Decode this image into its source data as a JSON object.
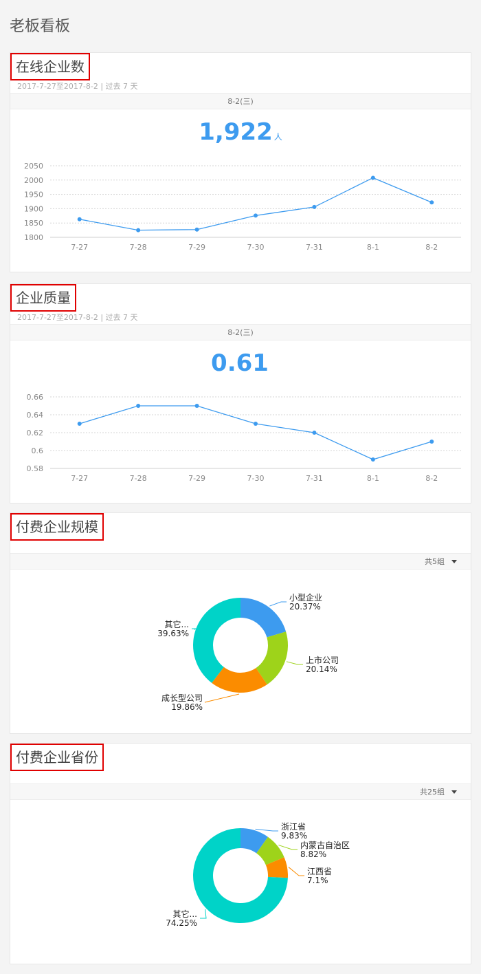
{
  "page": {
    "title": "老板看板"
  },
  "cards": [
    {
      "title": "在线企业数",
      "subtitle": "2017-7-27至2017-8-2 | 过去 7 天",
      "date_label": "8-2(三)",
      "big_value": "1,922",
      "big_unit": "人"
    },
    {
      "title": "企业质量",
      "subtitle": "2017-7-27至2017-8-2 | 过去 7 天",
      "date_label": "8-2(三)",
      "big_value": "0.61",
      "big_unit": ""
    },
    {
      "title": "付费企业规模",
      "group_label": "共5组"
    },
    {
      "title": "付费企业省份",
      "group_label": "共25组"
    }
  ],
  "chart_data": [
    {
      "type": "line",
      "categories": [
        "7-27",
        "7-28",
        "7-29",
        "7-30",
        "7-31",
        "8-1",
        "8-2"
      ],
      "series": [
        {
          "values": [
            1863,
            1825,
            1827,
            1876,
            1906,
            2008,
            1922
          ]
        }
      ],
      "yticks": [
        1800,
        1850,
        1900,
        1950,
        2000,
        2050
      ],
      "ylim": [
        1800,
        2050
      ],
      "color": "#3d9bef",
      "grid": true
    },
    {
      "type": "line",
      "categories": [
        "7-27",
        "7-28",
        "7-29",
        "7-30",
        "7-31",
        "8-1",
        "8-2"
      ],
      "series": [
        {
          "values": [
            0.63,
            0.65,
            0.65,
            0.63,
            0.62,
            0.59,
            0.61
          ]
        }
      ],
      "yticks": [
        0.58,
        0.6,
        0.62,
        0.64,
        0.66
      ],
      "ylim": [
        0.58,
        0.66
      ],
      "color": "#3d9bef",
      "grid": true
    },
    {
      "type": "pie",
      "donut": true,
      "slices": [
        {
          "label": "小型企业",
          "value_label": "20.37%",
          "value": 20.37,
          "color": "#3d9bef"
        },
        {
          "label": "上市公司",
          "value_label": "20.14%",
          "value": 20.14,
          "color": "#9ed31a"
        },
        {
          "label": "成长型公司",
          "value_label": "19.86%",
          "value": 19.86,
          "color": "#fb8c00"
        },
        {
          "label": "其它...",
          "value_label": "39.63%",
          "value": 39.63,
          "color": "#00d3c8"
        }
      ]
    },
    {
      "type": "pie",
      "donut": true,
      "slices": [
        {
          "label": "浙江省",
          "value_label": "9.83%",
          "value": 9.83,
          "color": "#3d9bef"
        },
        {
          "label": "内蒙古自治区",
          "value_label": "8.82%",
          "value": 8.82,
          "color": "#9ed31a"
        },
        {
          "label": "江西省",
          "value_label": "7.1%",
          "value": 7.1,
          "color": "#fb8c00"
        },
        {
          "label": "其它...",
          "value_label": "74.25%",
          "value": 74.25,
          "color": "#00d3c8"
        }
      ]
    }
  ]
}
